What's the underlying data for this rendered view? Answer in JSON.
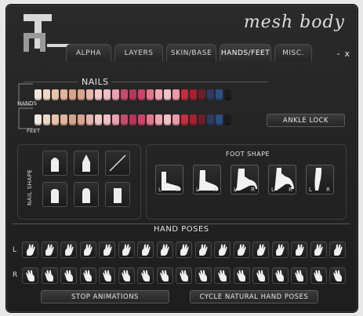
{
  "brand": "mesh body",
  "tabs": [
    "ALPHA",
    "LAYERS",
    "SKIN/BASE",
    "HANDS/FEET",
    "MISC."
  ],
  "window_controls": {
    "minimize": "-",
    "close": "x"
  },
  "nails": {
    "title": "NAILS",
    "hands_label": "HANDS",
    "feet_label": "FEET",
    "hand_colors": [
      "#efe6de",
      "#efd7c7",
      "#e8c3a8",
      "#e1b39a",
      "#d7a38a",
      "#d9a48f",
      "#e7b5ae",
      "#f0c8c7",
      "#f2bcc4",
      "#ee9fb1",
      "#c64c6b",
      "#b53659",
      "#d0416e",
      "#e4768b",
      "#f0a6b2",
      "#f4c1c8",
      "#ec98a7",
      "#c42e40",
      "#a81f2d",
      "#6a1f2a",
      "#2e3a5e",
      "#2a4f86",
      "#1b1b1b"
    ],
    "feet_colors": [
      "#efe6de",
      "#efd7c7",
      "#e8c3a8",
      "#e1b39a",
      "#d7a38a",
      "#d9a48f",
      "#e7b5ae",
      "#f0c8c7",
      "#f2bcc4",
      "#ee9fb1",
      "#c64c6b",
      "#b53659",
      "#d0416e",
      "#e4768b",
      "#f0a6b2",
      "#f4c1c8",
      "#ec98a7",
      "#c42e40",
      "#a81f2d",
      "#6a1f2a",
      "#2e3a5e",
      "#2a4f86",
      "#1b1b1b"
    ],
    "ankle_lock_label": "ANKLE LOCK"
  },
  "nail_shape": {
    "label": "NAIL SHAPE",
    "options": [
      "round-nail-icon",
      "pointed-nail-icon",
      "no-nail-icon",
      "square-nail-icon",
      "oval-nail-icon",
      "long-square-nail-icon"
    ]
  },
  "foot_shape": {
    "title": "FOOT SHAPE",
    "options": [
      "flat",
      "low-heel",
      "mid-heel",
      "high-heel",
      "tiptoe"
    ],
    "left": "L",
    "right": "R"
  },
  "hand_poses": {
    "title": "HAND POSES",
    "left_label": "L",
    "right_label": "R",
    "count": 17
  },
  "buttons": {
    "stop": "STOP ANIMATIONS",
    "cycle": "CYCLE NATURAL HAND POSES"
  }
}
